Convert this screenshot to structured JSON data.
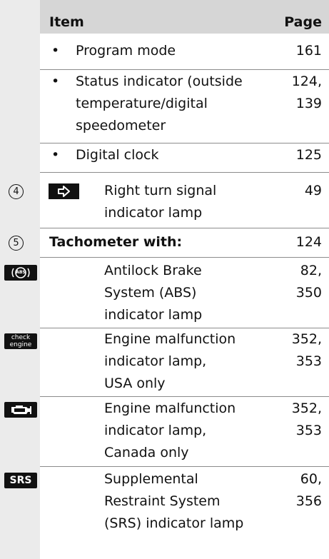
{
  "header": {
    "item": "Item",
    "page": "Page"
  },
  "rows": {
    "program_mode": {
      "label": "Program mode",
      "page": "161"
    },
    "status_indicator": {
      "line1": "Status indicator (outside",
      "line2": "temperature/digital",
      "line3": "speedometer",
      "page1": "124,",
      "page2": "139"
    },
    "digital_clock": {
      "label": "Digital clock",
      "page": "125"
    },
    "right_turn": {
      "number": "4",
      "line1": "Right turn signal",
      "line2": "indicator lamp",
      "page": "49"
    },
    "tachometer": {
      "number": "5",
      "label": "Tachometer with:",
      "page": "124"
    },
    "abs": {
      "icon_text": "ABS",
      "line1": "Antilock Brake",
      "line2": "System (ABS)",
      "line3": "indicator lamp",
      "page1": "82,",
      "page2": "350"
    },
    "check_engine": {
      "icon_line1": "check",
      "icon_line2": "engine",
      "line1": "Engine malfunction",
      "line2": "indicator lamp,",
      "line3": "USA only",
      "page1": "352,",
      "page2": "353"
    },
    "engine_canada": {
      "line1": "Engine malfunction",
      "line2": "indicator lamp,",
      "line3": "Canada only",
      "page1": "352,",
      "page2": "353"
    },
    "srs": {
      "icon_text": "SRS",
      "line1": "Supplemental",
      "line2": "Restraint System",
      "line3": "(SRS) indicator lamp",
      "page1": "60,",
      "page2": "356"
    }
  },
  "colors": {
    "sidebar": "#ebebeb",
    "header": "#d6d6d6",
    "rule": "#8c8c8c",
    "icon": "#111111"
  }
}
